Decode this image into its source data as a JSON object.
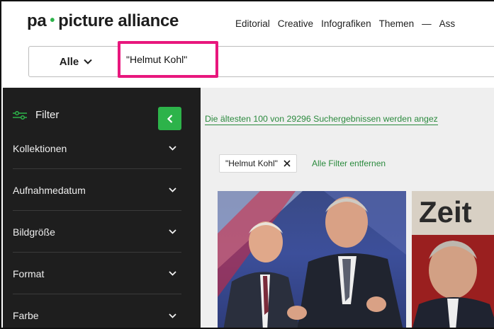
{
  "header": {
    "logo_left": "pa",
    "logo_right": "picture alliance",
    "nav": [
      "Editorial",
      "Creative",
      "Infografiken",
      "Themen",
      "—",
      "Ass"
    ]
  },
  "search": {
    "scope_label": "Alle",
    "query": "\"Helmut Kohl\""
  },
  "sidebar": {
    "filter_label": "Filter",
    "facets": [
      "Kollektionen",
      "Aufnahmedatum",
      "Bildgröße",
      "Format",
      "Farbe"
    ]
  },
  "results": {
    "note": "Die ältesten 100 von 29296 Suchergebnissen werden angez",
    "active_filter_chip": "\"Helmut Kohl\"",
    "clear_filters_label": "Alle Filter entfernen",
    "thumb2_text": "Zeit"
  },
  "colors": {
    "brand_green": "#2db34a",
    "highlight_pink": "#e8177d",
    "sidebar_bg": "#1e1e1e"
  },
  "icons": {
    "scope_dropdown": "chevron-down-icon",
    "filter": "sliders-icon",
    "collapse": "chevron-left-icon",
    "facet_expand": "chevron-down-icon",
    "chip_remove": "close-icon"
  }
}
